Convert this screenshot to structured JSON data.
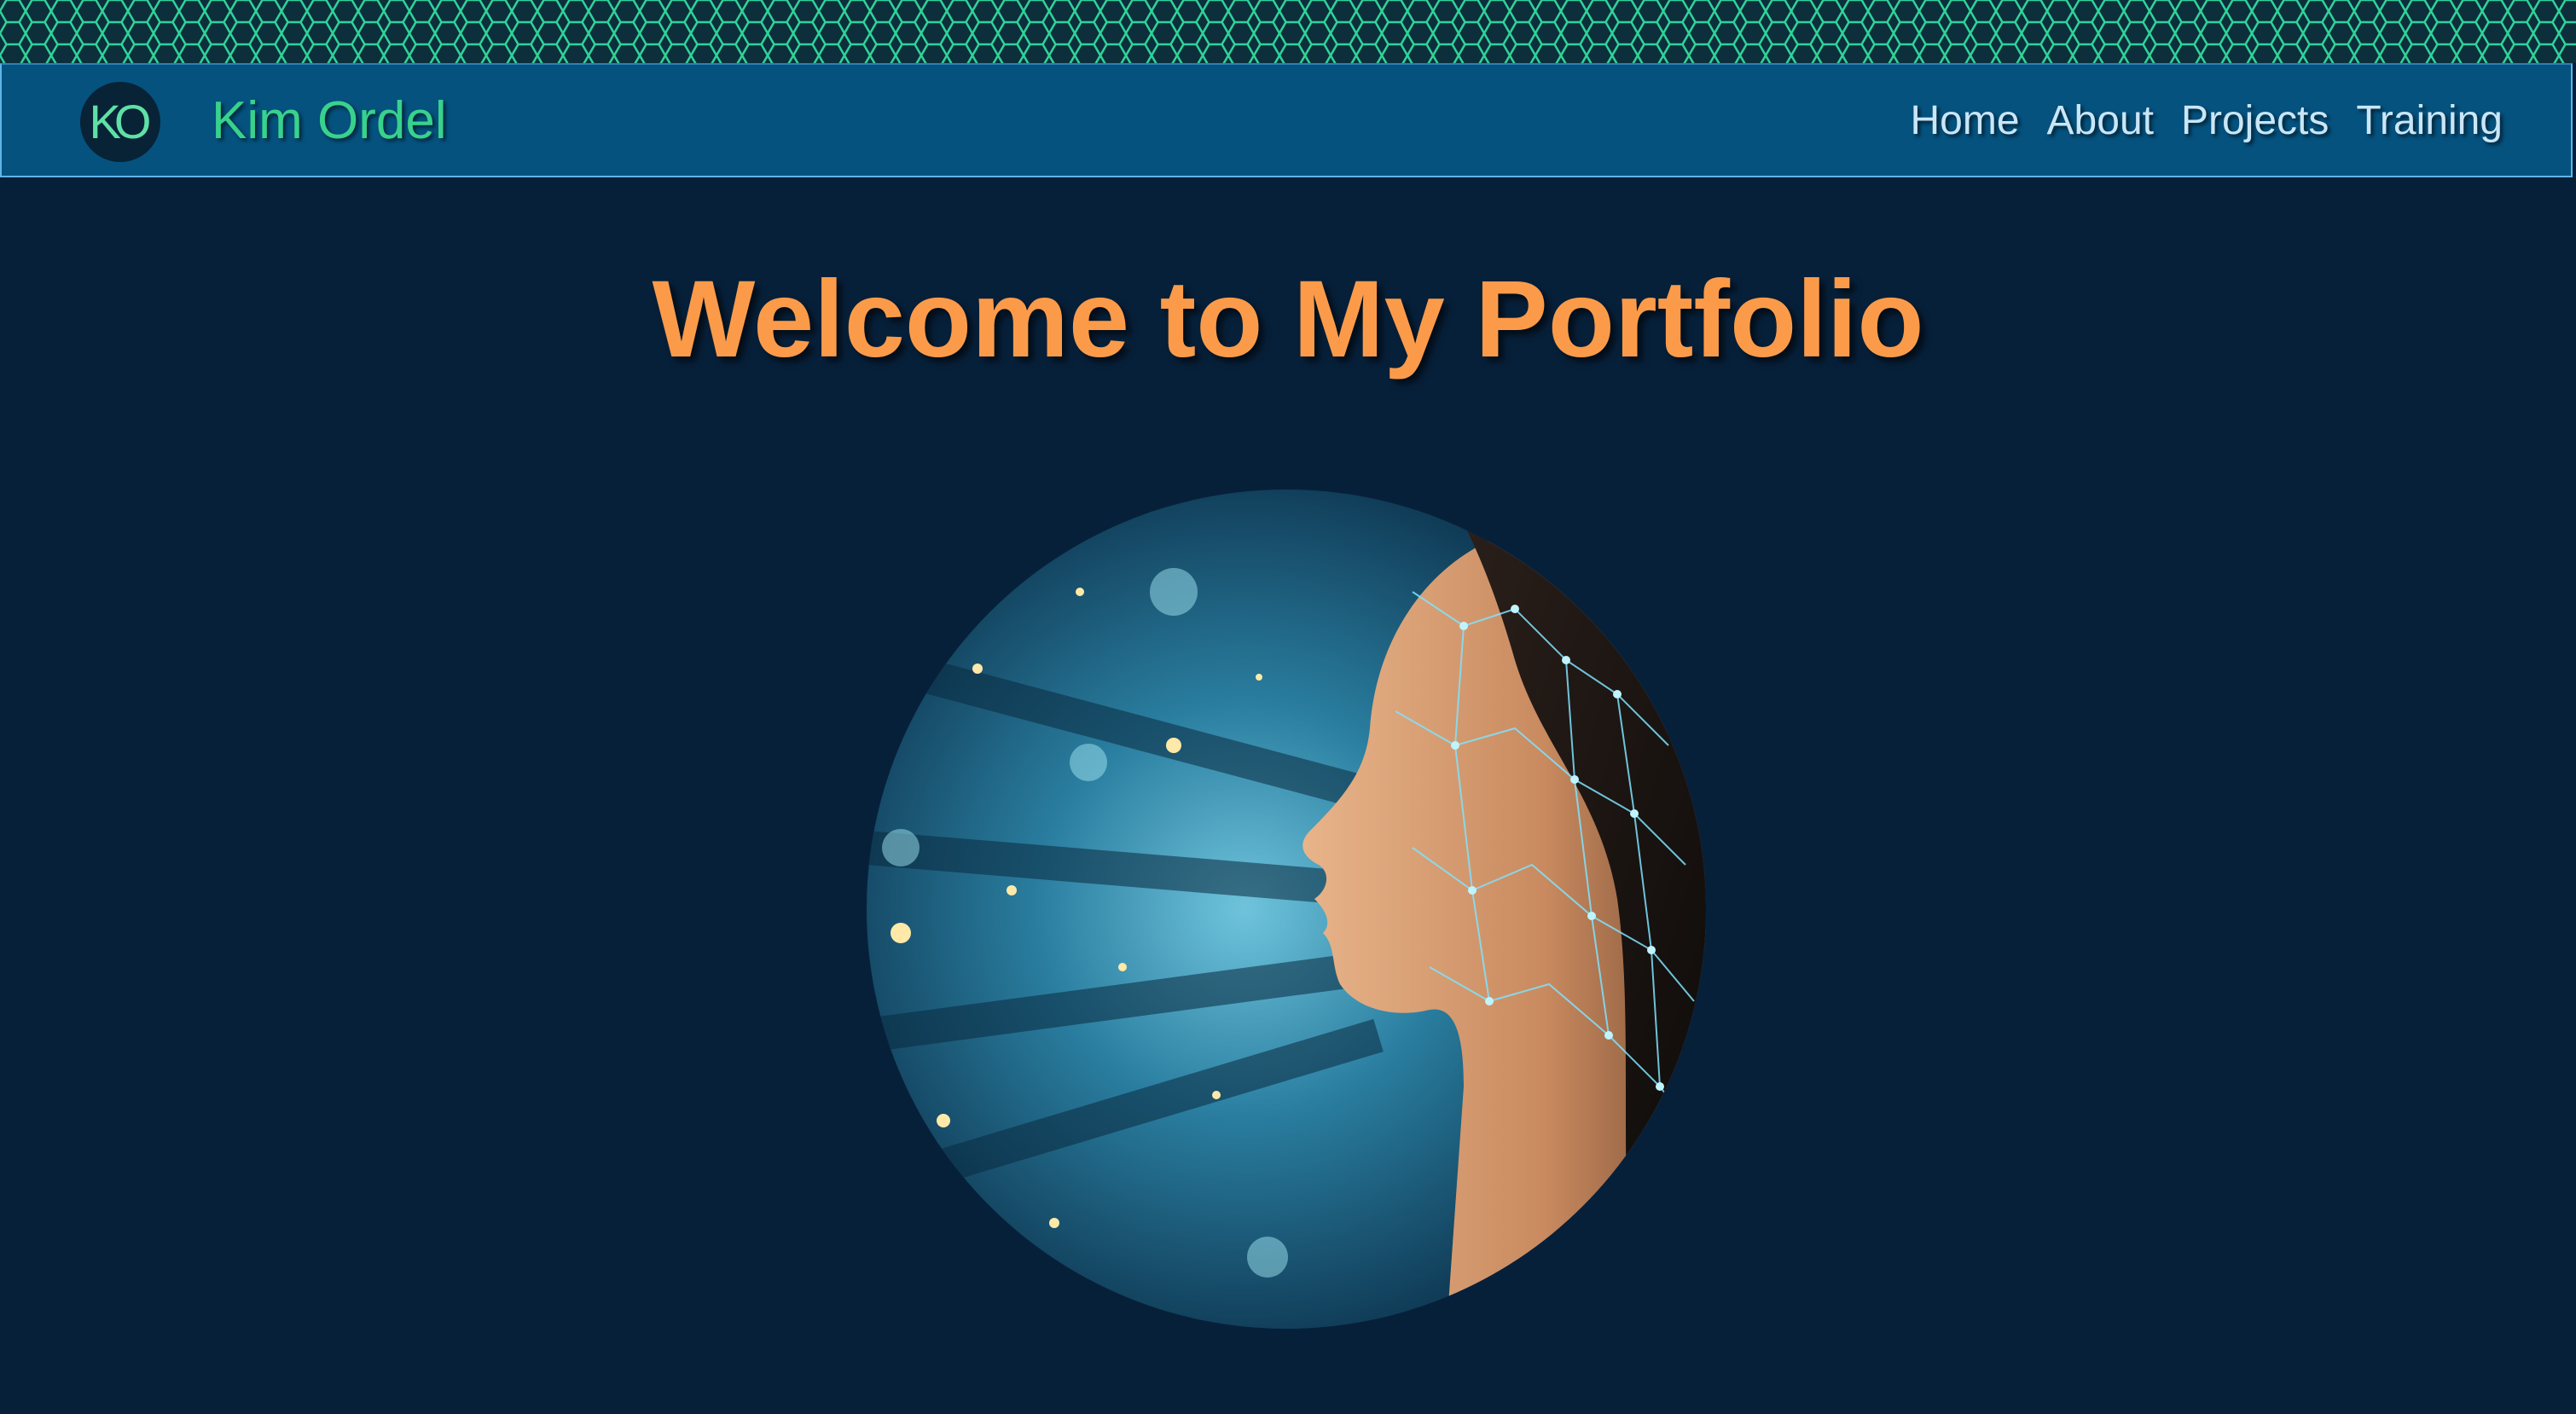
{
  "header": {
    "logo_initials": "KO",
    "brand_name": "Kim Ordel",
    "nav": [
      {
        "label": "Home"
      },
      {
        "label": "About"
      },
      {
        "label": "Projects"
      },
      {
        "label": "Training"
      }
    ]
  },
  "main": {
    "title": "Welcome to My Portfolio"
  },
  "colors": {
    "page_background": "#07203a",
    "navbar_background": "#05527f",
    "brand_text": "#38d28c",
    "nav_text": "#c9e6f7",
    "title_text": "#fb9b4a",
    "hex_pattern_stroke": "#2fd39a"
  }
}
